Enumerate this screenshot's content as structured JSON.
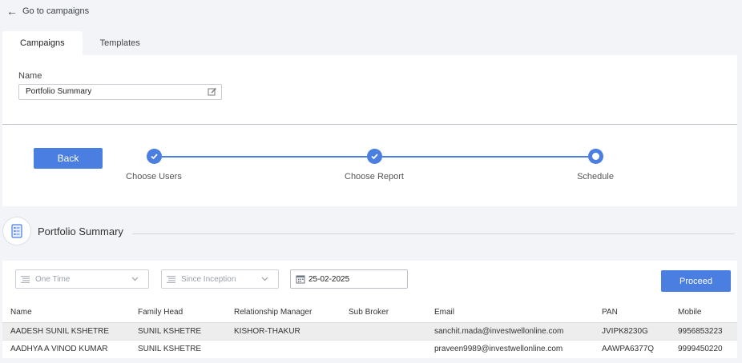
{
  "nav": {
    "back_link": "Go to campaigns"
  },
  "tabs": [
    {
      "label": "Campaigns",
      "active": true
    },
    {
      "label": "Templates",
      "active": false
    }
  ],
  "campaign": {
    "name_label": "Name",
    "name_value": "Portfolio Summary"
  },
  "buttons": {
    "back": "Back",
    "proceed": "Proceed"
  },
  "steps": [
    {
      "label": "Choose Users",
      "state": "done"
    },
    {
      "label": "Choose Report",
      "state": "done"
    },
    {
      "label": "Schedule",
      "state": "current"
    }
  ],
  "report": {
    "title": "Portfolio Summary"
  },
  "filters": {
    "frequency": "One Time",
    "period": "Since Inception",
    "date": "25-02-2025"
  },
  "table": {
    "headers": [
      "Name",
      "Family Head",
      "Relationship Manager",
      "Sub Broker",
      "Email",
      "PAN",
      "Mobile"
    ],
    "rows": [
      [
        "AADESH SUNIL KSHETRE",
        "SUNIL KSHETRE",
        "KISHOR-THAKUR",
        "",
        "sanchit.mada@investwellonline.com",
        "JVIPK8230G",
        "9956853223"
      ],
      [
        "AADHYA A VINOD KUMAR",
        "SUNIL KSHETRE",
        "",
        "",
        "praveen9989@investwellonline.com",
        "AAWPA6377Q",
        "9999450220"
      ]
    ]
  },
  "colors": {
    "accent": "#4a7ee0",
    "background": "#f3f4f8",
    "row_shade": "#ededed"
  },
  "icons": [
    "arrow-left-icon",
    "edit-icon",
    "check-icon",
    "report-icon",
    "list-icon",
    "chevron-down-icon",
    "calendar-icon"
  ]
}
